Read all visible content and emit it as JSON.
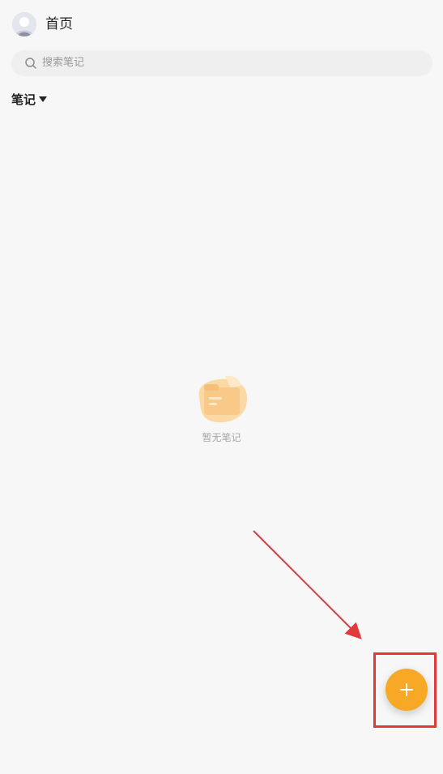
{
  "header": {
    "title": "首页",
    "avatar_icon": "user-avatar-icon"
  },
  "search": {
    "placeholder": "搜索笔记",
    "icon": "search-icon"
  },
  "section": {
    "label": "笔记",
    "dropdown_icon": "caret-down-icon"
  },
  "empty_state": {
    "message": "暂无笔记",
    "illustration": "empty-folder-illustration"
  },
  "fab": {
    "icon": "plus-icon",
    "color": "#f7a825"
  },
  "annotation": {
    "highlight_color": "#e03a3a"
  },
  "colors": {
    "background": "#f7f7f7",
    "accent": "#f7a825"
  }
}
